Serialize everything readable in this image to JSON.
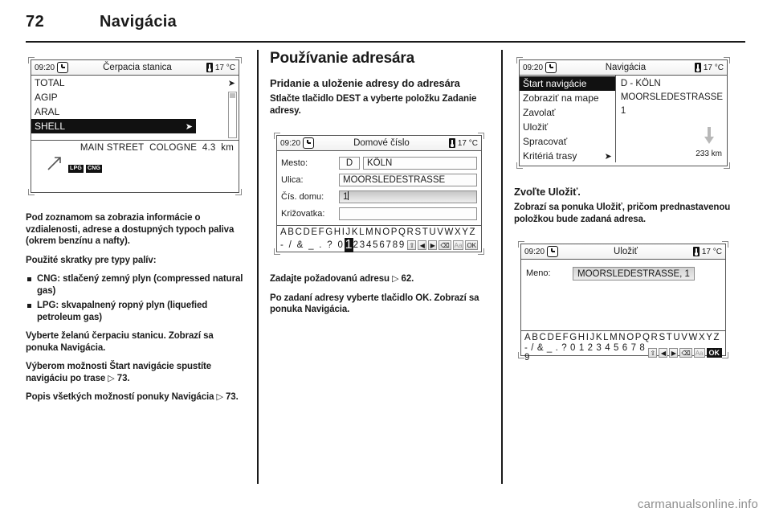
{
  "header": {
    "page_number": "72",
    "chapter": "Navigácia"
  },
  "watermark": "carmanualsonline.info",
  "col1": {
    "fig_fuel": {
      "status": {
        "time": "09:20",
        "title": "Čerpacia stanica",
        "temp": "17 °C"
      },
      "list": [
        {
          "label": "TOTAL",
          "selected": false
        },
        {
          "label": "AGIP",
          "selected": false
        },
        {
          "label": "ARAL",
          "selected": false
        },
        {
          "label": "SHELL",
          "selected": true
        }
      ],
      "poi": {
        "street": "MAIN STREET",
        "city": "COLOGNE",
        "distance": "4.3",
        "unit": "km",
        "fuel_tags": [
          "LPG",
          "CNG"
        ]
      }
    },
    "p1": "Pod zoznamom sa zobrazia informácie o vzdialenosti, adrese a dostupných typoch paliva (okrem benzínu a nafty).",
    "p2": "Použité skratky pre typy palív:",
    "bullets": [
      "CNG: stlačený zemný plyn (compressed natural gas)",
      "LPG: skvapalnený ropný plyn (liquefied petroleum gas)"
    ],
    "p3a": "Vyberte želanú čerpaciu stanicu.",
    "p3b": "Zobrazí sa ponuka Navigácia.",
    "p4": "Výberom možnosti Štart navigácie spustíte navigáciu po trase",
    "p4_ref": "73.",
    "p5": "Popis všetkých možností ponuky Navigácia",
    "p5_ref": "73."
  },
  "col2": {
    "h2": "Používanie adresára",
    "h3": "Pridanie a uloženie adresy do adresára",
    "p1": "Stlačte tlačidlo DEST a vyberte položku Zadanie adresy.",
    "fig_house": {
      "status": {
        "time": "09:20",
        "title": "Domové číslo",
        "temp": "17 °C"
      },
      "fields": [
        {
          "label": "Mesto:",
          "country": "D",
          "value": "KÖLN",
          "style": "plain"
        },
        {
          "label": "Ulica:",
          "value": "MOORSLEDESTRASSE",
          "style": "plain"
        },
        {
          "label": "Čís. domu:",
          "value": "1",
          "style": "highlight"
        },
        {
          "label": "Križovatka:",
          "value": "",
          "style": "plain"
        }
      ],
      "keyboard": {
        "row1": "ABCDEFGHIJKLMNOPQRSTUVWXYZ",
        "row2_pre": "- / & _ . ? 0",
        "row2_selected": "1",
        "row2_post": "23456789",
        "keys": [
          "⇧",
          "◀",
          "▶",
          "⌫",
          "Aa",
          "OK"
        ],
        "selected_key": "OK"
      }
    },
    "p2": "Zadajte požadovanú adresu",
    "p2_ref": "62.",
    "p3": "Po zadaní adresy vyberte tlačidlo OK. Zobrazí sa ponuka Navigácia."
  },
  "col3": {
    "fig_nav": {
      "status": {
        "time": "09:20",
        "title": "Navigácia",
        "temp": "17 °C"
      },
      "menu": [
        {
          "label": "Štart navigácie",
          "selected": true,
          "submenu": false
        },
        {
          "label": "Zobraziť na mape",
          "selected": false,
          "submenu": false
        },
        {
          "label": "Zavolať",
          "selected": false,
          "submenu": false
        },
        {
          "label": "Uložiť",
          "selected": false,
          "submenu": false
        },
        {
          "label": "Spracovať",
          "selected": false,
          "submenu": false
        },
        {
          "label": "Kritériá trasy",
          "selected": false,
          "submenu": true
        }
      ],
      "destination": [
        "D - KÖLN",
        "MOORSLEDESTRASSE",
        "1"
      ],
      "distance": "233 km"
    },
    "h3": "Zvoľte Uložiť.",
    "p1": "Zobrazí sa ponuka Uložiť, pričom prednastavenou položkou bude zadaná adresa.",
    "fig_save": {
      "status": {
        "time": "09:20",
        "title": "Uložiť",
        "temp": "17 °C"
      },
      "field": {
        "label": "Meno:",
        "value": "MOORSLEDESTRASSE, 1"
      },
      "keyboard": {
        "row1": "ABCDEFGHIJKLMNOPQRSTUVWXYZ",
        "row2": "- / & _ . ? 0 1 2 3 4 5 6 7 8 9",
        "keys": [
          "⇧",
          "◀",
          "▶",
          "⌫",
          "Aa",
          "OK"
        ],
        "selected_key": "OK"
      }
    }
  }
}
